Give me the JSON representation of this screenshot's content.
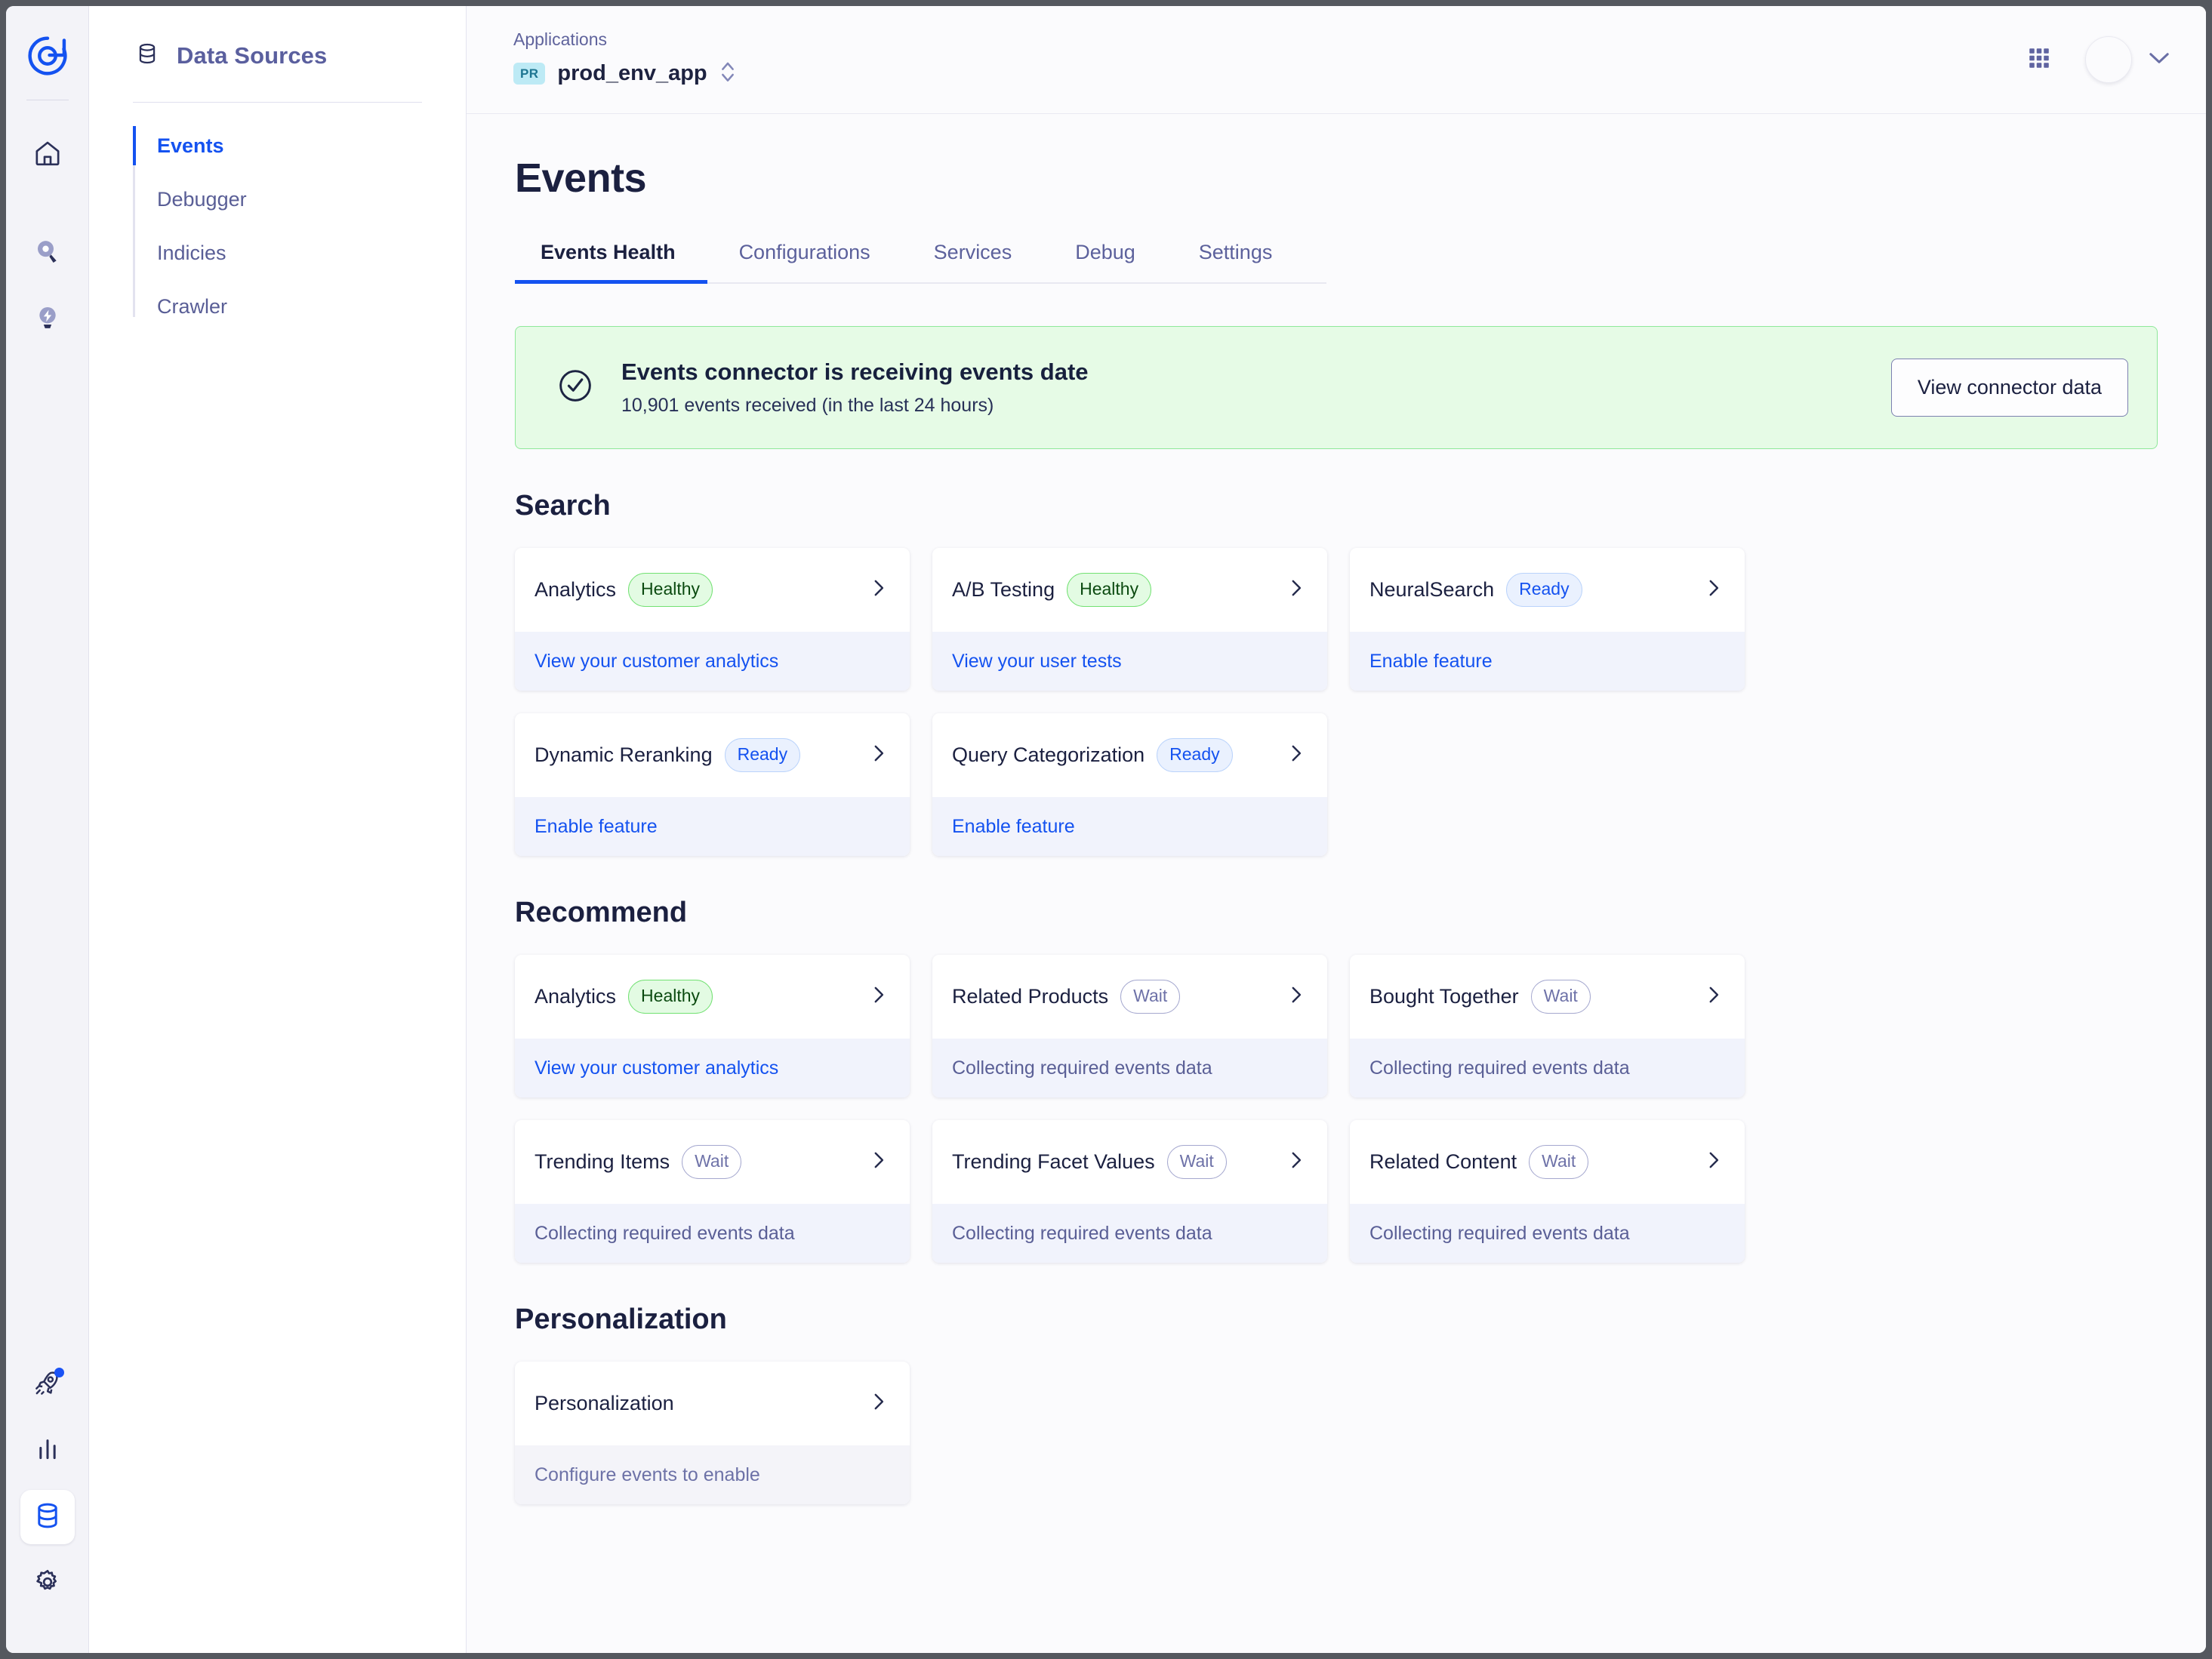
{
  "rail": {
    "logo_icon": "algolia-logo-icon",
    "items": [
      {
        "icon": "home-icon",
        "name": "home"
      },
      {
        "icon": "search-pin-icon",
        "name": "search"
      },
      {
        "icon": "lightbulb-icon",
        "name": "recommend"
      }
    ],
    "bottom_items": [
      {
        "icon": "rocket-icon",
        "name": "launch",
        "badge": true
      },
      {
        "icon": "bar-chart-icon",
        "name": "analytics",
        "badge": false
      },
      {
        "icon": "database-icon",
        "name": "data-sources",
        "badge": false,
        "active": true
      },
      {
        "icon": "gear-icon",
        "name": "settings",
        "badge": false
      }
    ]
  },
  "nav": {
    "icon": "database-icon",
    "title": "Data Sources",
    "items": [
      {
        "label": "Events",
        "active": true
      },
      {
        "label": "Debugger",
        "active": false
      },
      {
        "label": "Indicies",
        "active": false
      },
      {
        "label": "Crawler",
        "active": false
      }
    ]
  },
  "topbar": {
    "app_label": "Applications",
    "app_pill": "PR",
    "app_name": "prod_env_app",
    "selector_icon": "chevron-up-down-icon",
    "apps_grid_icon": "apps-grid-icon",
    "avatar_icon": "avatar",
    "account_chevron_icon": "chevron-down-icon"
  },
  "page": {
    "title": "Events",
    "tabs": [
      {
        "label": "Events Health",
        "active": true
      },
      {
        "label": "Configurations",
        "active": false
      },
      {
        "label": "Services",
        "active": false
      },
      {
        "label": "Debug",
        "active": false
      },
      {
        "label": "Settings",
        "active": false
      }
    ]
  },
  "banner": {
    "icon": "check-circle-icon",
    "title": "Events connector is receiving events date",
    "subtitle": "10,901 events received (in the last 24 hours)",
    "button_label": "View connector data",
    "bg_color": "#e6fbe6",
    "border_color": "#8fe89a"
  },
  "sections": [
    {
      "title": "Search",
      "cards": [
        {
          "name": "Analytics",
          "badge": "Healthy",
          "badge_kind": "healthy",
          "footer": "View your customer analytics",
          "footer_kind": "link"
        },
        {
          "name": "A/B Testing",
          "badge": "Healthy",
          "badge_kind": "healthy",
          "footer": "View your user tests",
          "footer_kind": "link"
        },
        {
          "name": "NeuralSearch",
          "badge": "Ready",
          "badge_kind": "ready",
          "footer": "Enable feature",
          "footer_kind": "link"
        },
        {
          "name": "Dynamic Reranking",
          "badge": "Ready",
          "badge_kind": "ready",
          "footer": "Enable feature",
          "footer_kind": "link"
        },
        {
          "name": "Query Categorization",
          "badge": "Ready",
          "badge_kind": "ready",
          "footer": "Enable feature",
          "footer_kind": "link"
        }
      ]
    },
    {
      "title": "Recommend",
      "cards": [
        {
          "name": "Analytics",
          "badge": "Healthy",
          "badge_kind": "healthy",
          "footer": "View your customer analytics",
          "footer_kind": "link"
        },
        {
          "name": "Related Products",
          "badge": "Wait",
          "badge_kind": "wait",
          "footer": "Collecting required events data",
          "footer_kind": "muted"
        },
        {
          "name": "Bought Together",
          "badge": "Wait",
          "badge_kind": "wait",
          "footer": "Collecting required events data",
          "footer_kind": "muted"
        },
        {
          "name": "Trending Items",
          "badge": "Wait",
          "badge_kind": "wait",
          "footer": "Collecting required events data",
          "footer_kind": "muted"
        },
        {
          "name": "Trending Facet Values",
          "badge": "Wait",
          "badge_kind": "wait",
          "footer": "Collecting required events data",
          "footer_kind": "muted"
        },
        {
          "name": "Related Content",
          "badge": "Wait",
          "badge_kind": "wait",
          "footer": "Collecting required events data",
          "footer_kind": "muted"
        }
      ]
    },
    {
      "title": "Personalization",
      "cards": [
        {
          "name": "Personalization",
          "badge": "",
          "badge_kind": "",
          "footer": "Configure events to enable",
          "footer_kind": "muted-2"
        }
      ]
    }
  ],
  "colors": {
    "accent": "#1452f0",
    "healthy": "#0b4a10",
    "ready": "#1452f0",
    "wait": "#6e72a8"
  }
}
